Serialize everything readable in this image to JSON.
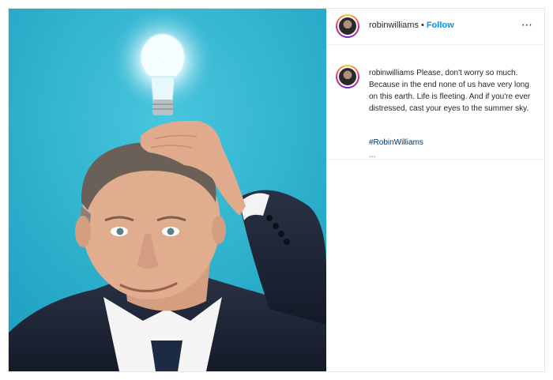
{
  "post": {
    "username": "robinwilliams",
    "separator": "•",
    "follow_label": "Follow",
    "more_icon": "more-horizontal-icon",
    "caption_user": "robinwilliams",
    "caption_text": "Please, don't worry so much. Because in the end none of us have very long on this earth. Life is fleeting. And if you're ever distressed, cast your eyes to the summer sky.",
    "hashtag": "#RobinWilliams",
    "more_dots": "•••"
  },
  "colors": {
    "accent": "#0095f6",
    "hashtag": "#00376b",
    "photo_background": "#2bb2cf"
  }
}
